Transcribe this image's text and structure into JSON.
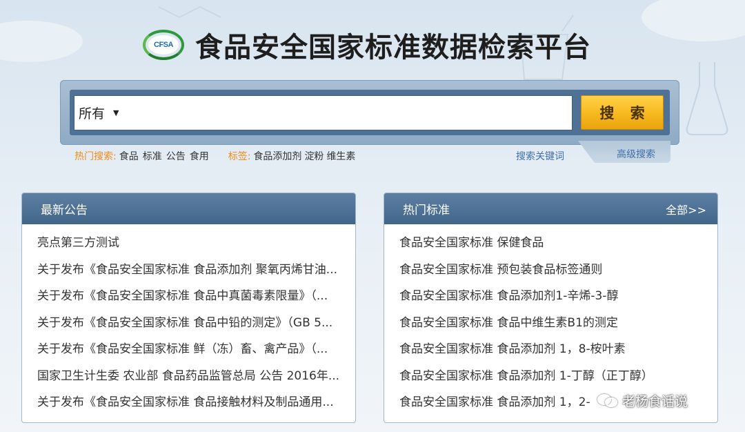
{
  "header": {
    "logo_text": "CFSA",
    "title": "食品安全国家标准数据检索平台"
  },
  "search": {
    "scope_selected": "所有",
    "input_value": "",
    "button_label": "搜 索",
    "hot_label": "热门搜索:",
    "hot_words": [
      "食品",
      "标准",
      "公告",
      "食用"
    ],
    "tag_label": "标签:",
    "tag_words": [
      "食品添加剂",
      "淀粉",
      "维生素"
    ],
    "keyword_link": "搜索关键词",
    "advanced_link": "高级搜索"
  },
  "announcements": {
    "title": "最新公告",
    "items": [
      "亮点第三方测试",
      "关于发布《食品安全国家标准 食品添加剂 聚氧丙烯甘油...",
      "关于发布《食品安全国家标准 食品中真菌毒素限量》（...",
      "关于发布《食品安全国家标准 食品中铅的测定》（GB 5...",
      "关于发布《食品安全国家标准 鲜（冻）畜、禽产品》（...",
      "国家卫生计生委 农业部 食品药品监管总局 公告 2016年...",
      "关于发布《食品安全国家标准 食品接触材料及制品通用..."
    ]
  },
  "hot_standards": {
    "title": "热门标准",
    "more_label": "全部>>",
    "items": [
      "食品安全国家标准 保健食品",
      "食品安全国家标准 预包装食品标签通则",
      "食品安全国家标准 食品添加剂1-辛烯-3-醇",
      "食品安全国家标准 食品中维生素B1的测定",
      "食品安全国家标准 食品添加剂 1，8-桉叶素",
      "食品安全国家标准 食品添加剂 1-丁醇（正丁醇）",
      "食品安全国家标准 食品添加剂 1，2-"
    ]
  },
  "watermark": {
    "text": "老杨食话说"
  },
  "colors": {
    "panel_header": "#4d7096",
    "accent_orange": "#f08c1b",
    "link_blue": "#3f6fa8",
    "search_button": "#f7b81e"
  }
}
